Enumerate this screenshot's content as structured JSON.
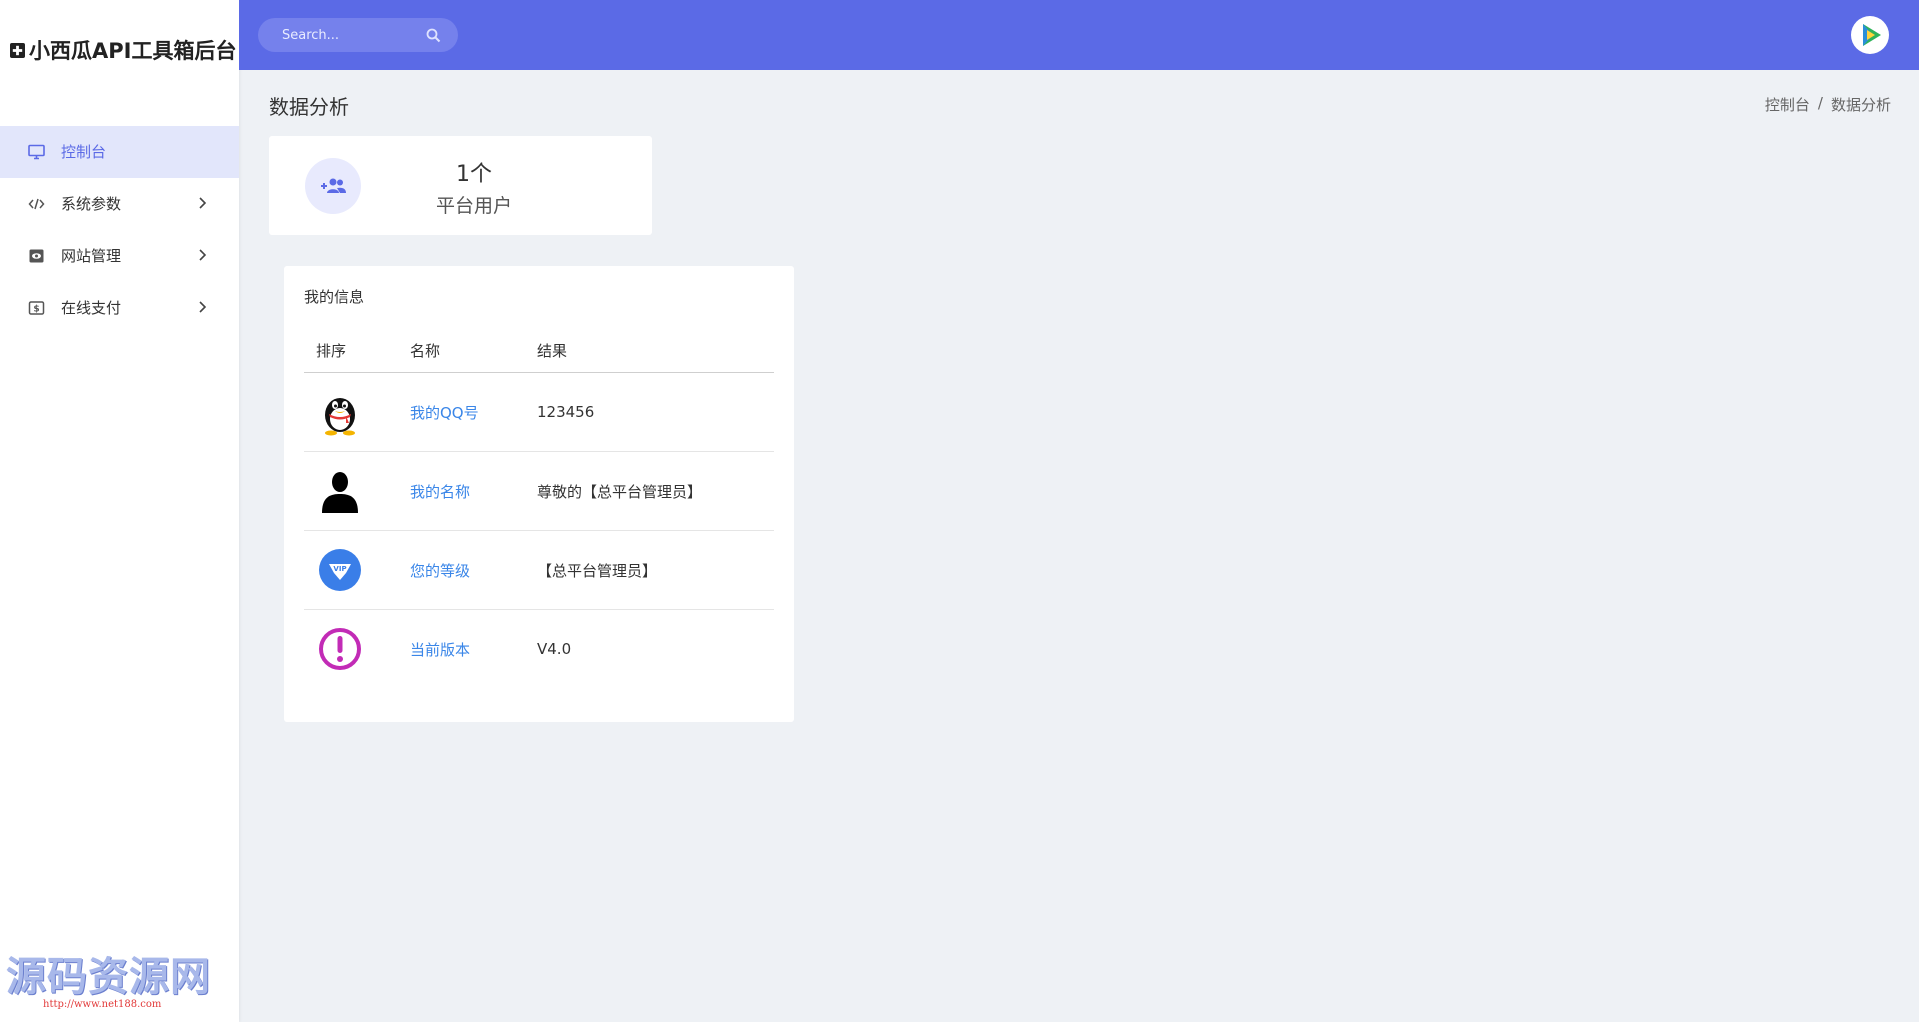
{
  "brand": {
    "title": "小西瓜API工具箱后台"
  },
  "sidebar": {
    "items": [
      {
        "label": "控制台",
        "icon": "monitor-icon",
        "active": true
      },
      {
        "label": "系统参数",
        "icon": "code-icon",
        "active": false
      },
      {
        "label": "网站管理",
        "icon": "eye-box-icon",
        "active": false
      },
      {
        "label": "在线支付",
        "icon": "dollar-box-icon",
        "active": false
      }
    ]
  },
  "topbar": {
    "search_placeholder": "Search..."
  },
  "page": {
    "title": "数据分析",
    "breadcrumb": [
      "控制台",
      "/",
      "数据分析"
    ]
  },
  "stat": {
    "value": "1个",
    "label": "平台用户"
  },
  "info": {
    "title": "我的信息",
    "headers": [
      "排序",
      "名称",
      "结果"
    ],
    "rows": [
      {
        "icon": "qq-penguin-icon",
        "name": "我的QQ号",
        "result": "123456"
      },
      {
        "icon": "user-silhouette-icon",
        "name": "我的名称",
        "result": "尊敬的【总平台管理员】"
      },
      {
        "icon": "vip-badge-icon",
        "name": "您的等级",
        "result": "【总平台管理员】"
      },
      {
        "icon": "exclamation-icon",
        "name": "当前版本",
        "result": "V4.0"
      }
    ]
  },
  "watermark": {
    "big": "源码资源网",
    "small": "http://www.net188.com"
  },
  "colors": {
    "primary": "#5b6ae6",
    "link": "#3a86e8",
    "background": "#eef1f5"
  }
}
